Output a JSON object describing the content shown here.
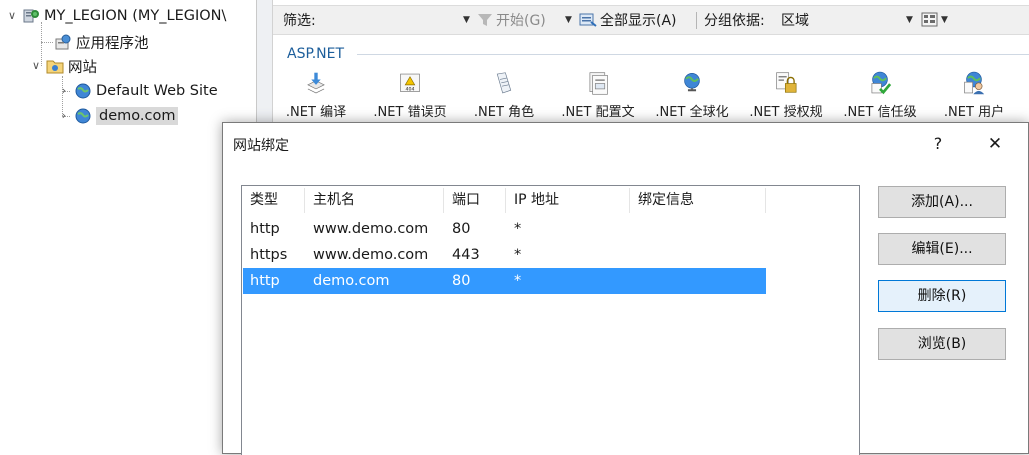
{
  "tree": {
    "server": "MY_LEGION (MY_LEGION\\",
    "app_pools": "应用程序池",
    "sites": "网站",
    "default_site": "Default Web Site",
    "demo_site": "demo.com"
  },
  "filter_bar": {
    "filter_label": "筛选:",
    "filter_value": "",
    "start_label": "开始(G)",
    "show_all_label": "全部显示(A)",
    "group_by_label": "分组依据:",
    "group_by_value": "区域"
  },
  "group": {
    "title": "ASP.NET"
  },
  "features": [
    {
      "label": ".NET 编译",
      "icon": "compile-icon"
    },
    {
      "label": ".NET 错误页",
      "icon": "error-page-icon"
    },
    {
      "label": ".NET 角色",
      "icon": "roles-icon"
    },
    {
      "label": ".NET 配置文",
      "icon": "profile-icon"
    },
    {
      "label": ".NET 全球化",
      "icon": "globe-icon"
    },
    {
      "label": ".NET 授权规",
      "icon": "lock-icon"
    },
    {
      "label": ".NET 信任级",
      "icon": "trust-icon"
    },
    {
      "label": ".NET 用户",
      "icon": "users-icon"
    }
  ],
  "dialog": {
    "title": "网站绑定",
    "help": "?",
    "close": "✕",
    "columns": [
      "类型",
      "主机名",
      "端口",
      "IP 地址",
      "绑定信息"
    ],
    "rows": [
      {
        "type": "http",
        "host": "www.demo.com",
        "port": "80",
        "ip": "*",
        "info": ""
      },
      {
        "type": "https",
        "host": "www.demo.com",
        "port": "443",
        "ip": "*",
        "info": ""
      },
      {
        "type": "http",
        "host": "demo.com",
        "port": "80",
        "ip": "*",
        "info": ""
      }
    ],
    "selected_row": 2,
    "buttons": {
      "add": "添加(A)...",
      "edit": "编辑(E)...",
      "remove": "删除(R)",
      "browse": "浏览(B)"
    }
  },
  "colors": {
    "selection": "#3399ff",
    "group_title": "#1c5e9b"
  }
}
